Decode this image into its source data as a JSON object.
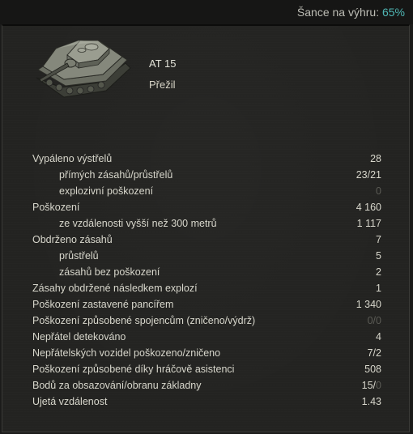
{
  "header": {
    "win_chance_label": "Šance na výhru:",
    "win_chance_value": "65%"
  },
  "vehicle": {
    "name": "AT 15",
    "status": "Přežil",
    "icon": "tank-destroyer-image"
  },
  "stats": [
    {
      "label": "Vypáleno výstřelů",
      "value": "28",
      "sub": false
    },
    {
      "label": "přímých zásahů/průstřelů",
      "value": "23/21",
      "sub": true
    },
    {
      "label": "explozivní poškození",
      "value": "0",
      "sub": true,
      "dim": true
    },
    {
      "label": "Poškození",
      "value": "4 160",
      "sub": false
    },
    {
      "label": "ze vzdálenosti vyšší než 300 metrů",
      "value": "1 117",
      "sub": true
    },
    {
      "label": "Obdrženo zásahů",
      "value": "7",
      "sub": false
    },
    {
      "label": "průstřelů",
      "value": "5",
      "sub": true
    },
    {
      "label": "zásahů bez poškození",
      "value": "2",
      "sub": true
    },
    {
      "label": "Zásahy obdržené následkem explozí",
      "value": "1",
      "sub": false
    },
    {
      "label": "Poškození zastavené pancířem",
      "value": "1 340",
      "sub": false
    },
    {
      "label": "Poškození způsobené spojencům (zničeno/výdrž)",
      "value": "0/0",
      "sub": false,
      "dim": true
    },
    {
      "label": "Nepřátel detekováno",
      "value": "4",
      "sub": false
    },
    {
      "label": "Nepřátelských vozidel poškozeno/zničeno",
      "value": "7/2",
      "sub": false
    },
    {
      "label": "Poškození způsobené díky hráčově asistenci",
      "value": "508",
      "sub": false
    },
    {
      "label": "Bodů za obsazování/obranu základny",
      "value_main": "15/",
      "value_dim": "0",
      "sub": false,
      "split": true
    },
    {
      "label": "Ujetá vzdálenost",
      "value": "1.43",
      "sub": false
    }
  ],
  "colors": {
    "accent": "#4fb6b4",
    "text": "#d8d7cc",
    "dim": "#5c5c56",
    "background": "#232321"
  }
}
